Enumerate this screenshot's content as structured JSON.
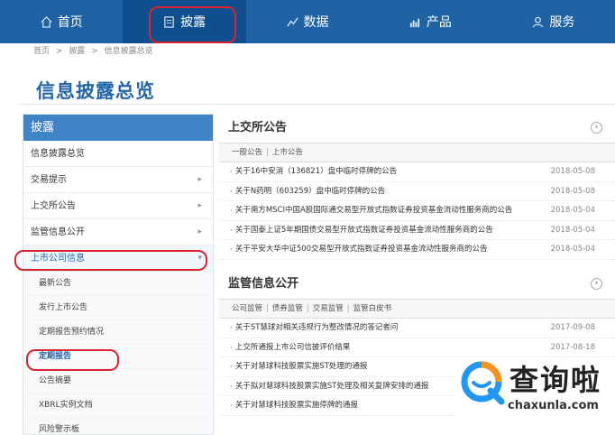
{
  "nav": [
    {
      "label": "首页",
      "icon": "home-icon"
    },
    {
      "label": "披露",
      "icon": "document-icon"
    },
    {
      "label": "数据",
      "icon": "chart-line-icon"
    },
    {
      "label": "产品",
      "icon": "bar-chart-icon"
    },
    {
      "label": "服务",
      "icon": "person-icon"
    }
  ],
  "breadcrumb": [
    "首页",
    ">",
    "披露",
    ">",
    "信息披露总览"
  ],
  "page_title": "信息披露总览",
  "sidebar": {
    "heading": "披露",
    "items": [
      {
        "label": "信息披露总览",
        "arrow": ""
      },
      {
        "label": "交易提示",
        "arrow": "▸"
      },
      {
        "label": "上交所公告",
        "arrow": "▸"
      },
      {
        "label": "监管信息公开",
        "arrow": "▸"
      },
      {
        "label": "上市公司信息",
        "arrow": "▾"
      }
    ],
    "subitems": [
      "最新公告",
      "发行上市公告",
      "定期报告预约情况",
      "定期报告",
      "公告摘要",
      "XBRL实例文档",
      "风险警示板"
    ]
  },
  "announcements": {
    "title": "上交所公告",
    "more": "›",
    "tabs": [
      "一般公告",
      "上市公告"
    ],
    "rows": [
      {
        "text": "关于16中安消（136821）盘中临时停牌的公告",
        "date": "2018-05-08"
      },
      {
        "text": "关于N药明（603259）盘中临时停牌的公告",
        "date": "2018-05-08"
      },
      {
        "text": "关于南方MSCI中国A股国际通交易型开放式指数证券投资基金流动性服务商的公告",
        "date": "2018-05-04"
      },
      {
        "text": "关于国泰上证5年期国债交易型开放式指数证券投资基金流动性服务商的公告",
        "date": "2018-05-04"
      },
      {
        "text": "关于平安大华中证500交易型开放式指数证券投资基金流动性服务商的公告",
        "date": "2018-05-04"
      }
    ]
  },
  "supervision": {
    "title": "监管信息公开",
    "more": "›",
    "tabs": [
      "公司监管",
      "债券监管",
      "交易监管",
      "监管白皮书"
    ],
    "rows": [
      {
        "text": "关于ST慧球对相关违规行为整改情况的答记者问",
        "date": "2017-09-08"
      },
      {
        "text": "上交所通报上市公司信披评价结果",
        "date": "2017-08-18"
      },
      {
        "text": "关于对慧球科技股票实施ST处理的通报",
        "date": ""
      },
      {
        "text": "关于拟对慧球科技股票实施ST处理及相关复牌安排的通报",
        "date": ""
      },
      {
        "text": "关于对慧球科技股票实施停牌的通报",
        "date": ""
      }
    ]
  },
  "watermark": {
    "brand": "查询啦",
    "url": "chaxunla.com"
  },
  "colors": {
    "nav_bg": "#1f63a5",
    "accent": "#2466a8",
    "highlight": "#d9232e"
  }
}
